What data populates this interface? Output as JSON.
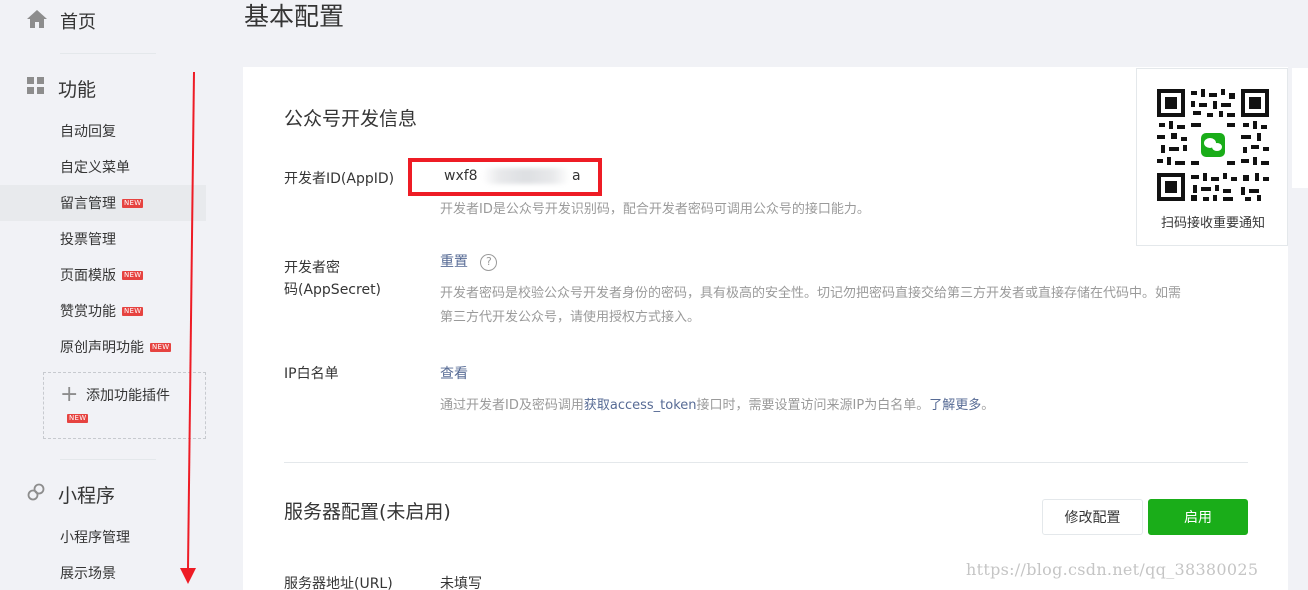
{
  "sidebar": {
    "home": {
      "label": "首页",
      "icon": "home-icon"
    },
    "features": {
      "label": "功能",
      "icon": "grid-icon",
      "items": [
        {
          "label": "自动回复",
          "new": false
        },
        {
          "label": "自定义菜单",
          "new": false
        },
        {
          "label": "留言管理",
          "new": true,
          "active": true
        },
        {
          "label": "投票管理",
          "new": false
        },
        {
          "label": "页面模版",
          "new": true
        },
        {
          "label": "赞赏功能",
          "new": true
        },
        {
          "label": "原创声明功能",
          "new": true
        }
      ],
      "add_plugin": {
        "label": "添加功能插件",
        "new": true
      }
    },
    "miniprogram": {
      "label": "小程序",
      "icon": "link-icon",
      "items": [
        {
          "label": "小程序管理"
        },
        {
          "label": "展示场景"
        }
      ]
    },
    "new_badge_text": "NEW"
  },
  "page": {
    "title": "基本配置"
  },
  "dev_info": {
    "title": "公众号开发信息",
    "appid": {
      "label": "开发者ID(AppID)",
      "value_prefix": "wxf8",
      "value_suffix": "a",
      "desc": "开发者ID是公众号开发识别码，配合开发者密码可调用公众号的接口能力。"
    },
    "appsecret": {
      "label_line1": "开发者密",
      "label_line2": "码(AppSecret)",
      "action": "重置",
      "help": "?",
      "desc_line1": "开发者密码是校验公众号开发者身份的密码，具有极高的安全性。切记勿把密码直接交给第三方开发者或直接存储在代码中。如需",
      "desc_line2": "第三方代开发公众号，请使用授权方式接入。"
    },
    "ip_whitelist": {
      "label": "IP白名单",
      "action": "查看",
      "desc_pre": "通过开发者ID及密码调用",
      "desc_link1": "获取access_token",
      "desc_mid": "接口时，需要设置访问来源IP为白名单。",
      "desc_link2": "了解更多",
      "desc_end": "。"
    }
  },
  "server_config": {
    "title": "服务器配置(未启用)",
    "modify_button": "修改配置",
    "enable_button": "启用",
    "url_label": "服务器地址(URL)",
    "url_value": "未填写"
  },
  "qr": {
    "caption": "扫码接收重要通知"
  },
  "watermark": "https://blog.csdn.net/qq_38380025",
  "colors": {
    "accent_green": "#1aad19",
    "link": "#576b95",
    "annotation_red": "#ee1c25",
    "new_badge": "#e64340"
  }
}
